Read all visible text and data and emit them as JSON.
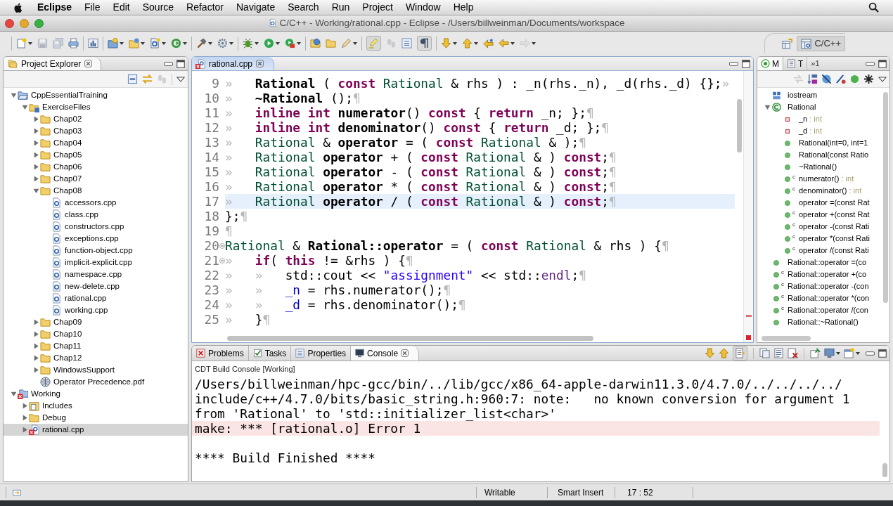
{
  "menu_bar": {
    "app_name": "Eclipse",
    "menus": [
      "File",
      "Edit",
      "Source",
      "Refactor",
      "Navigate",
      "Search",
      "Run",
      "Project",
      "Window",
      "Help"
    ]
  },
  "window": {
    "title": "C/C++ - Working/rational.cpp - Eclipse - /Users/billweinman/Documents/workspace"
  },
  "toolbar": {
    "groups": [
      [
        {
          "kind": "new-file",
          "dropdown": true,
          "disabled": false,
          "pressed": false
        },
        {
          "kind": "save",
          "dropdown": false,
          "disabled": true,
          "pressed": false
        },
        {
          "kind": "save-all",
          "dropdown": false,
          "disabled": true,
          "pressed": false
        },
        {
          "kind": "print",
          "dropdown": false,
          "disabled": false,
          "pressed": false
        }
      ],
      [
        {
          "kind": "chart-box",
          "dropdown": false,
          "disabled": false,
          "pressed": false
        }
      ],
      [
        {
          "kind": "c-folder",
          "dropdown": true,
          "disabled": false,
          "pressed": false
        },
        {
          "kind": "folder-plus",
          "dropdown": true,
          "disabled": false,
          "pressed": false
        },
        {
          "kind": "c-file",
          "dropdown": true,
          "disabled": false,
          "pressed": false
        },
        {
          "kind": "ring-arrow",
          "dropdown": true,
          "disabled": false,
          "pressed": false
        }
      ],
      [
        {
          "kind": "hammer",
          "dropdown": true,
          "disabled": false,
          "pressed": false
        },
        {
          "kind": "gear",
          "dropdown": true,
          "disabled": false,
          "pressed": false
        }
      ],
      [
        {
          "kind": "bug",
          "dropdown": true,
          "disabled": false,
          "pressed": false
        },
        {
          "kind": "play",
          "dropdown": true,
          "disabled": false,
          "pressed": false
        },
        {
          "kind": "play-case",
          "dropdown": true,
          "disabled": false,
          "pressed": false
        }
      ],
      [
        {
          "kind": "folder-globe",
          "dropdown": false,
          "disabled": false,
          "pressed": false
        },
        {
          "kind": "folder",
          "dropdown": false,
          "disabled": false,
          "pressed": false
        },
        {
          "kind": "pen",
          "dropdown": true,
          "disabled": false,
          "pressed": false
        }
      ],
      [
        {
          "kind": "highlighter",
          "dropdown": false,
          "disabled": false,
          "pressed": true
        },
        {
          "kind": "steps",
          "dropdown": false,
          "disabled": true,
          "pressed": false
        },
        {
          "kind": "list",
          "dropdown": false,
          "disabled": false,
          "pressed": false
        },
        {
          "kind": "paragraph",
          "dropdown": false,
          "disabled": false,
          "pressed": true
        }
      ],
      [
        {
          "kind": "pin-down",
          "dropdown": true,
          "disabled": false,
          "pressed": false
        },
        {
          "kind": "pin-up",
          "dropdown": true,
          "disabled": false,
          "pressed": false
        },
        {
          "kind": "arrow-star",
          "dropdown": false,
          "disabled": false,
          "pressed": false
        },
        {
          "kind": "arrow-left",
          "dropdown": true,
          "disabled": false,
          "pressed": false
        },
        {
          "kind": "arrow-right",
          "dropdown": true,
          "disabled": true,
          "pressed": false
        }
      ]
    ]
  },
  "perspectives": [
    {
      "label": "C/C++",
      "selected": true
    }
  ],
  "project_explorer": {
    "tab": {
      "label": "Project Explorer",
      "selected": true
    },
    "toolbar": [
      {
        "kind": "collapse-all",
        "disabled": false
      },
      {
        "kind": "link-arrows",
        "disabled": false
      },
      {
        "kind": "steps",
        "disabled": true
      }
    ],
    "tree": [
      {
        "label": "CppEssentialTraining",
        "kind": "project",
        "expanded": true,
        "selected": false,
        "children": [
          {
            "label": "ExerciseFiles",
            "kind": "source-folder",
            "expanded": true,
            "selected": false,
            "children": [
              {
                "label": "Chap02",
                "kind": "folder",
                "expanded": false,
                "selected": false
              },
              {
                "label": "Chap03",
                "kind": "folder",
                "expanded": false,
                "selected": false
              },
              {
                "label": "Chap04",
                "kind": "folder",
                "expanded": false,
                "selected": false
              },
              {
                "label": "Chap05",
                "kind": "folder",
                "expanded": false,
                "selected": false
              },
              {
                "label": "Chap06",
                "kind": "folder",
                "expanded": false,
                "selected": false
              },
              {
                "label": "Chap07",
                "kind": "folder",
                "expanded": false,
                "selected": false
              },
              {
                "label": "Chap08",
                "kind": "folder",
                "expanded": true,
                "selected": false,
                "children": [
                  {
                    "label": "accessors.cpp",
                    "kind": "cpp-file",
                    "selected": false
                  },
                  {
                    "label": "class.cpp",
                    "kind": "cpp-file",
                    "selected": false
                  },
                  {
                    "label": "constructors.cpp",
                    "kind": "cpp-file",
                    "selected": false
                  },
                  {
                    "label": "exceptions.cpp",
                    "kind": "cpp-file",
                    "selected": false
                  },
                  {
                    "label": "function-object.cpp",
                    "kind": "cpp-file",
                    "selected": false
                  },
                  {
                    "label": "implicit-explicit.cpp",
                    "kind": "cpp-file",
                    "selected": false
                  },
                  {
                    "label": "namespace.cpp",
                    "kind": "cpp-file",
                    "selected": false
                  },
                  {
                    "label": "new-delete.cpp",
                    "kind": "cpp-file",
                    "selected": false
                  },
                  {
                    "label": "rational.cpp",
                    "kind": "cpp-file",
                    "selected": false
                  },
                  {
                    "label": "working.cpp",
                    "kind": "cpp-file",
                    "selected": false
                  }
                ]
              },
              {
                "label": "Chap09",
                "kind": "folder",
                "expanded": false,
                "selected": false
              },
              {
                "label": "Chap10",
                "kind": "folder",
                "expanded": false,
                "selected": false
              },
              {
                "label": "Chap11",
                "kind": "folder",
                "expanded": false,
                "selected": false
              },
              {
                "label": "Chap12",
                "kind": "folder",
                "expanded": false,
                "selected": false
              },
              {
                "label": "WindowsSupport",
                "kind": "folder",
                "expanded": false,
                "selected": false
              },
              {
                "label": "Operator Precedence.pdf",
                "kind": "pdf",
                "selected": false
              }
            ]
          }
        ]
      },
      {
        "label": "Working",
        "kind": "c-project-error",
        "expanded": true,
        "selected": false,
        "children": [
          {
            "label": "Includes",
            "kind": "includes",
            "expanded": false,
            "selected": false
          },
          {
            "label": "Debug",
            "kind": "folder",
            "expanded": false,
            "selected": false
          },
          {
            "label": "rational.cpp",
            "kind": "cpp-error",
            "expanded": false,
            "selected": true
          }
        ]
      }
    ]
  },
  "editor": {
    "tabs": [
      {
        "label": "rational.cpp",
        "selected": true
      }
    ],
    "lines": [
      {
        "number": "9",
        "current": false,
        "fold": false,
        "tokens": [
          {
            "kind": "tab",
            "text": "»"
          },
          {
            "kind": "decl",
            "text": "Rational"
          },
          {
            "kind": "plain",
            "text": " ( "
          },
          {
            "kind": "keyword",
            "text": "const"
          },
          {
            "kind": "type",
            "text": " Rational"
          },
          {
            "kind": "plain",
            "text": " & rhs ) : _n(rhs._n), _d(rhs._d) {};"
          },
          {
            "kind": "tab",
            "text": "»"
          }
        ]
      },
      {
        "number": "10",
        "current": false,
        "fold": false,
        "tokens": [
          {
            "kind": "tab",
            "text": "»"
          },
          {
            "kind": "decl",
            "text": "~Rational"
          },
          {
            "kind": "plain",
            "text": " ();"
          },
          {
            "kind": "eol",
            "text": "¶"
          }
        ]
      },
      {
        "number": "11",
        "current": false,
        "fold": false,
        "tokens": [
          {
            "kind": "tab",
            "text": "»"
          },
          {
            "kind": "keyword",
            "text": "inline"
          },
          {
            "kind": "keyword",
            "text": " int"
          },
          {
            "kind": "decl",
            "text": " numerator"
          },
          {
            "kind": "plain",
            "text": "() "
          },
          {
            "kind": "keyword",
            "text": "const"
          },
          {
            "kind": "plain",
            "text": " { "
          },
          {
            "kind": "keyword",
            "text": "return"
          },
          {
            "kind": "plain",
            "text": " _n; };"
          },
          {
            "kind": "eol",
            "text": "¶"
          }
        ]
      },
      {
        "number": "12",
        "current": false,
        "fold": false,
        "tokens": [
          {
            "kind": "tab",
            "text": "»"
          },
          {
            "kind": "keyword",
            "text": "inline"
          },
          {
            "kind": "keyword",
            "text": " int"
          },
          {
            "kind": "decl",
            "text": " denominator"
          },
          {
            "kind": "plain",
            "text": "() "
          },
          {
            "kind": "keyword",
            "text": "const"
          },
          {
            "kind": "plain",
            "text": " { "
          },
          {
            "kind": "keyword",
            "text": "return"
          },
          {
            "kind": "plain",
            "text": " _d; };"
          },
          {
            "kind": "eol",
            "text": "¶"
          }
        ]
      },
      {
        "number": "13",
        "current": false,
        "fold": false,
        "tokens": [
          {
            "kind": "tab",
            "text": "»"
          },
          {
            "kind": "type",
            "text": "Rational"
          },
          {
            "kind": "plain",
            "text": " & "
          },
          {
            "kind": "decl",
            "text": "operator"
          },
          {
            "kind": "plain",
            "text": " = ( "
          },
          {
            "kind": "keyword",
            "text": "const"
          },
          {
            "kind": "type",
            "text": " Rational"
          },
          {
            "kind": "plain",
            "text": " & );"
          },
          {
            "kind": "eol",
            "text": "¶"
          }
        ]
      },
      {
        "number": "14",
        "current": false,
        "fold": false,
        "tokens": [
          {
            "kind": "tab",
            "text": "»"
          },
          {
            "kind": "type",
            "text": "Rational"
          },
          {
            "kind": "decl",
            "text": " operator"
          },
          {
            "kind": "plain",
            "text": " + ( "
          },
          {
            "kind": "keyword",
            "text": "const"
          },
          {
            "kind": "type",
            "text": " Rational"
          },
          {
            "kind": "plain",
            "text": " & ) "
          },
          {
            "kind": "keyword",
            "text": "const"
          },
          {
            "kind": "plain",
            "text": ";"
          },
          {
            "kind": "eol",
            "text": "¶"
          }
        ]
      },
      {
        "number": "15",
        "current": false,
        "fold": false,
        "tokens": [
          {
            "kind": "tab",
            "text": "»"
          },
          {
            "kind": "type",
            "text": "Rational"
          },
          {
            "kind": "decl",
            "text": " operator"
          },
          {
            "kind": "plain",
            "text": " - ( "
          },
          {
            "kind": "keyword",
            "text": "const"
          },
          {
            "kind": "type",
            "text": " Rational"
          },
          {
            "kind": "plain",
            "text": " & ) "
          },
          {
            "kind": "keyword",
            "text": "const"
          },
          {
            "kind": "plain",
            "text": ";"
          },
          {
            "kind": "eol",
            "text": "¶"
          }
        ]
      },
      {
        "number": "16",
        "current": false,
        "fold": false,
        "tokens": [
          {
            "kind": "tab",
            "text": "»"
          },
          {
            "kind": "type",
            "text": "Rational"
          },
          {
            "kind": "decl",
            "text": " operator"
          },
          {
            "kind": "plain",
            "text": " * ( "
          },
          {
            "kind": "keyword",
            "text": "const"
          },
          {
            "kind": "type",
            "text": " Rational"
          },
          {
            "kind": "plain",
            "text": " & ) "
          },
          {
            "kind": "keyword",
            "text": "const"
          },
          {
            "kind": "plain",
            "text": ";"
          },
          {
            "kind": "eol",
            "text": "¶"
          }
        ]
      },
      {
        "number": "17",
        "current": true,
        "fold": false,
        "tokens": [
          {
            "kind": "tab",
            "text": "»"
          },
          {
            "kind": "type",
            "text": "Rational"
          },
          {
            "kind": "decl",
            "text": " operator"
          },
          {
            "kind": "plain",
            "text": " / ( "
          },
          {
            "kind": "keyword",
            "text": "const"
          },
          {
            "kind": "type",
            "text": " Rational"
          },
          {
            "kind": "plain",
            "text": " & ) "
          },
          {
            "kind": "keyword",
            "text": "const"
          },
          {
            "kind": "plain",
            "text": ";"
          },
          {
            "kind": "eol",
            "text": "¶"
          }
        ]
      },
      {
        "number": "18",
        "current": false,
        "fold": false,
        "tokens": [
          {
            "kind": "plain",
            "text": "};"
          },
          {
            "kind": "eol",
            "text": "¶"
          }
        ]
      },
      {
        "number": "19",
        "current": false,
        "fold": false,
        "tokens": [
          {
            "kind": "eol",
            "text": "¶"
          }
        ]
      },
      {
        "number": "20",
        "current": false,
        "fold": true,
        "tokens": [
          {
            "kind": "type",
            "text": "Rational"
          },
          {
            "kind": "plain",
            "text": " & "
          },
          {
            "kind": "decl",
            "text": "Rational::operator"
          },
          {
            "kind": "plain",
            "text": " = ( "
          },
          {
            "kind": "keyword",
            "text": "const"
          },
          {
            "kind": "type",
            "text": " Rational"
          },
          {
            "kind": "plain",
            "text": " & rhs ) {"
          },
          {
            "kind": "eol",
            "text": "¶"
          }
        ]
      },
      {
        "number": "21",
        "current": false,
        "fold": true,
        "tokens": [
          {
            "kind": "tab",
            "text": "»"
          },
          {
            "kind": "keyword",
            "text": "if"
          },
          {
            "kind": "plain",
            "text": "( "
          },
          {
            "kind": "keyword",
            "text": "this"
          },
          {
            "kind": "plain",
            "text": " != &rhs ) {"
          },
          {
            "kind": "eol",
            "text": "¶"
          }
        ]
      },
      {
        "number": "22",
        "current": false,
        "fold": false,
        "tokens": [
          {
            "kind": "tab",
            "text": "»"
          },
          {
            "kind": "tab",
            "text": "»"
          },
          {
            "kind": "plain",
            "text": "std::cout << "
          },
          {
            "kind": "string",
            "text": "\"assignment\""
          },
          {
            "kind": "plain",
            "text": " << std::"
          },
          {
            "kind": "macro",
            "text": "endl"
          },
          {
            "kind": "plain",
            "text": ";"
          },
          {
            "kind": "eol",
            "text": "¶"
          }
        ]
      },
      {
        "number": "23",
        "current": false,
        "fold": false,
        "tokens": [
          {
            "kind": "tab",
            "text": "»"
          },
          {
            "kind": "tab",
            "text": "»"
          },
          {
            "kind": "field",
            "text": "_n"
          },
          {
            "kind": "plain",
            "text": " = rhs.numerator();"
          },
          {
            "kind": "eol",
            "text": "¶"
          }
        ]
      },
      {
        "number": "24",
        "current": false,
        "fold": false,
        "tokens": [
          {
            "kind": "tab",
            "text": "»"
          },
          {
            "kind": "tab",
            "text": "»"
          },
          {
            "kind": "field",
            "text": "_d"
          },
          {
            "kind": "plain",
            "text": " = rhs.denominator();"
          },
          {
            "kind": "eol",
            "text": "¶"
          }
        ]
      },
      {
        "number": "25",
        "current": false,
        "fold": false,
        "tokens": [
          {
            "kind": "tab",
            "text": "»"
          },
          {
            "kind": "plain",
            "text": "}"
          },
          {
            "kind": "eol",
            "text": "¶"
          }
        ]
      }
    ]
  },
  "outline": {
    "tabs": [
      {
        "label": "M",
        "kind": "ring-dot",
        "selected": true
      },
      {
        "label": "T",
        "kind": "doc",
        "selected": false
      }
    ],
    "overflow": "»1",
    "toolbar": [
      {
        "kind": "grey-arrows",
        "disabled": true
      },
      {
        "kind": "sort-az",
        "disabled": false
      },
      {
        "kind": "hide-fields",
        "disabled": false
      },
      {
        "kind": "hide-static",
        "disabled": false
      },
      {
        "kind": "dot",
        "disabled": false
      },
      {
        "kind": "asterisk",
        "disabled": false
      }
    ],
    "items": [
      {
        "label": "iostream",
        "kind": "include"
      },
      {
        "label": "Rational",
        "kind": "class",
        "expanded": true,
        "children": [
          {
            "label": "_n",
            "type": ": int",
            "kind": "field"
          },
          {
            "label": "_d",
            "type": ": int",
            "kind": "field"
          },
          {
            "label": "Rational(int=0, int=1",
            "kind": "method"
          },
          {
            "label": "Rational(const Ratio",
            "kind": "method"
          },
          {
            "label": "~Rational()",
            "kind": "method"
          },
          {
            "label": "numerator()",
            "type": ": int",
            "kind": "method",
            "decorator": "c"
          },
          {
            "label": "denominator()",
            "type": ": int",
            "kind": "method",
            "decorator": "c"
          },
          {
            "label": "operator =(const Rat",
            "kind": "method"
          },
          {
            "label": "operator +(const Rat",
            "kind": "method",
            "decorator": "c"
          },
          {
            "label": "operator -(const Rati",
            "kind": "method",
            "decorator": "c"
          },
          {
            "label": "operator *(const Rati",
            "kind": "method",
            "decorator": "c"
          },
          {
            "label": "operator /(const Rati",
            "kind": "method",
            "decorator": "c"
          }
        ]
      },
      {
        "label": "Rational::operator =(co",
        "kind": "method"
      },
      {
        "label": "Rational::operator +(co",
        "kind": "method",
        "decorator": "c"
      },
      {
        "label": "Rational::operator -(con",
        "kind": "method",
        "decorator": "c"
      },
      {
        "label": "Rational::operator *(con",
        "kind": "method",
        "decorator": "c"
      },
      {
        "label": "Rational::operator /(con",
        "kind": "method",
        "decorator": "c"
      },
      {
        "label": "Rational::~Rational()",
        "kind": "method"
      }
    ]
  },
  "console": {
    "tabs": [
      {
        "label": "Problems",
        "kind": "problems",
        "selected": false
      },
      {
        "label": "Tasks",
        "kind": "tasks",
        "selected": false
      },
      {
        "label": "Properties",
        "kind": "properties",
        "selected": false
      },
      {
        "label": "Console",
        "kind": "console",
        "selected": true
      }
    ],
    "toolbar": {
      "groups": [
        [
          {
            "kind": "pin-down",
            "dropdown": false,
            "disabled": false,
            "pressed": false
          },
          {
            "kind": "pin-up",
            "dropdown": false,
            "disabled": false,
            "pressed": false
          },
          {
            "kind": "scroll-lock",
            "dropdown": false,
            "disabled": false,
            "pressed": true
          }
        ],
        [
          {
            "kind": "doc-copy",
            "dropdown": false,
            "disabled": false,
            "pressed": false
          },
          {
            "kind": "doc-lines",
            "dropdown": false,
            "disabled": false,
            "pressed": false
          },
          {
            "kind": "doc-x",
            "dropdown": false,
            "disabled": false,
            "pressed": false
          }
        ],
        [
          {
            "kind": "pin",
            "dropdown": false,
            "disabled": false,
            "pressed": false
          },
          {
            "kind": "monitor",
            "dropdown": true,
            "disabled": false,
            "pressed": false
          },
          {
            "kind": "new-window",
            "dropdown": true,
            "disabled": false,
            "pressed": false
          }
        ]
      ]
    },
    "title": "CDT Build Console [Working]",
    "lines": [
      {
        "kind": "output",
        "text": "/Users/billweinman/hpc-gcc/bin/../lib/gcc/x86_64-apple-darwin11.3.0/4.7.0/../../../../"
      },
      {
        "kind": "output",
        "text": "include/c++/4.7.0/bits/basic_string.h:960:7: note:   no known conversion for argument 1"
      },
      {
        "kind": "output",
        "text": "from 'Rational' to 'std::initializer_list<char>'"
      },
      {
        "kind": "error",
        "text": "make: *** [rational.o] Error 1"
      },
      {
        "kind": "blank"
      },
      {
        "kind": "output",
        "text": "**** Build Finished ****"
      }
    ]
  },
  "status_bar": {
    "fields": [
      "Writable",
      "Smart Insert",
      "17 : 52"
    ]
  }
}
